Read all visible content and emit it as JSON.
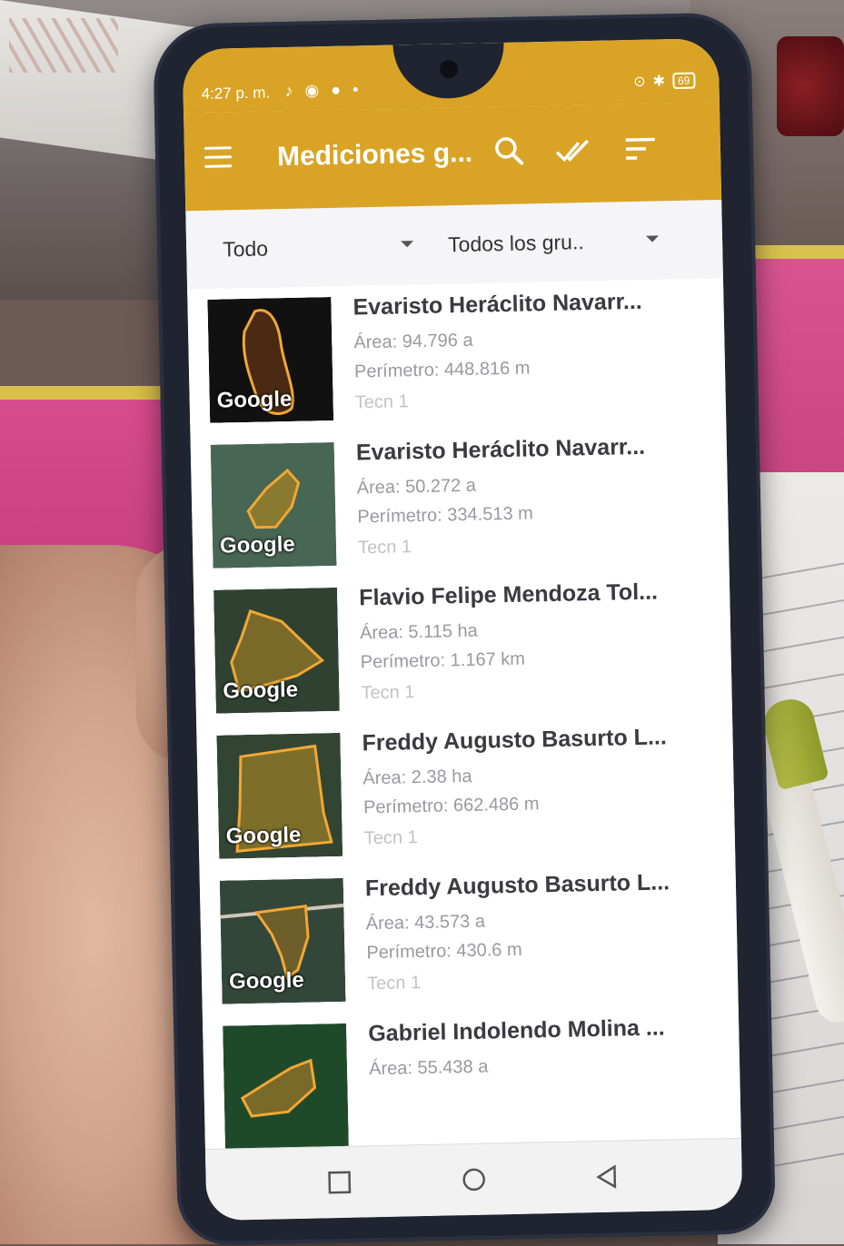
{
  "status_bar": {
    "time": "4:27 p. m.",
    "battery": "69"
  },
  "app_bar": {
    "title": "Mediciones g..."
  },
  "filters": {
    "type": "Todo",
    "group": "Todos los gru.."
  },
  "thumbnail_label": "Google",
  "items": [
    {
      "name": "Evaristo Heráclito Navarr...",
      "area": "Área: 94.796 a",
      "perimeter": "Perímetro: 448.816 m",
      "group": "Tecn 1"
    },
    {
      "name": "Evaristo Heráclito Navarr...",
      "area": "Área: 50.272 a",
      "perimeter": "Perímetro: 334.513 m",
      "group": "Tecn 1"
    },
    {
      "name": "Flavio Felipe Mendoza Tol...",
      "area": "Área: 5.115 ha",
      "perimeter": "Perímetro: 1.167 km",
      "group": "Tecn 1"
    },
    {
      "name": "Freddy Augusto Basurto L...",
      "area": "Área: 2.38 ha",
      "perimeter": "Perímetro: 662.486 m",
      "group": "Tecn 1"
    },
    {
      "name": "Freddy Augusto Basurto L...",
      "area": "Área: 43.573 a",
      "perimeter": "Perímetro: 430.6 m",
      "group": "Tecn 1"
    },
    {
      "name": "Gabriel Indolendo Molina ...",
      "area": "Área: 55.438 a",
      "perimeter": "",
      "group": ""
    }
  ],
  "colors": {
    "accent": "#d9a425",
    "polygon": "#f2a734"
  },
  "icons": [
    "menu-icon",
    "search-icon",
    "done-all-icon",
    "sort-icon",
    "dropdown-caret-icon",
    "recent-apps-icon",
    "home-icon",
    "back-icon"
  ]
}
